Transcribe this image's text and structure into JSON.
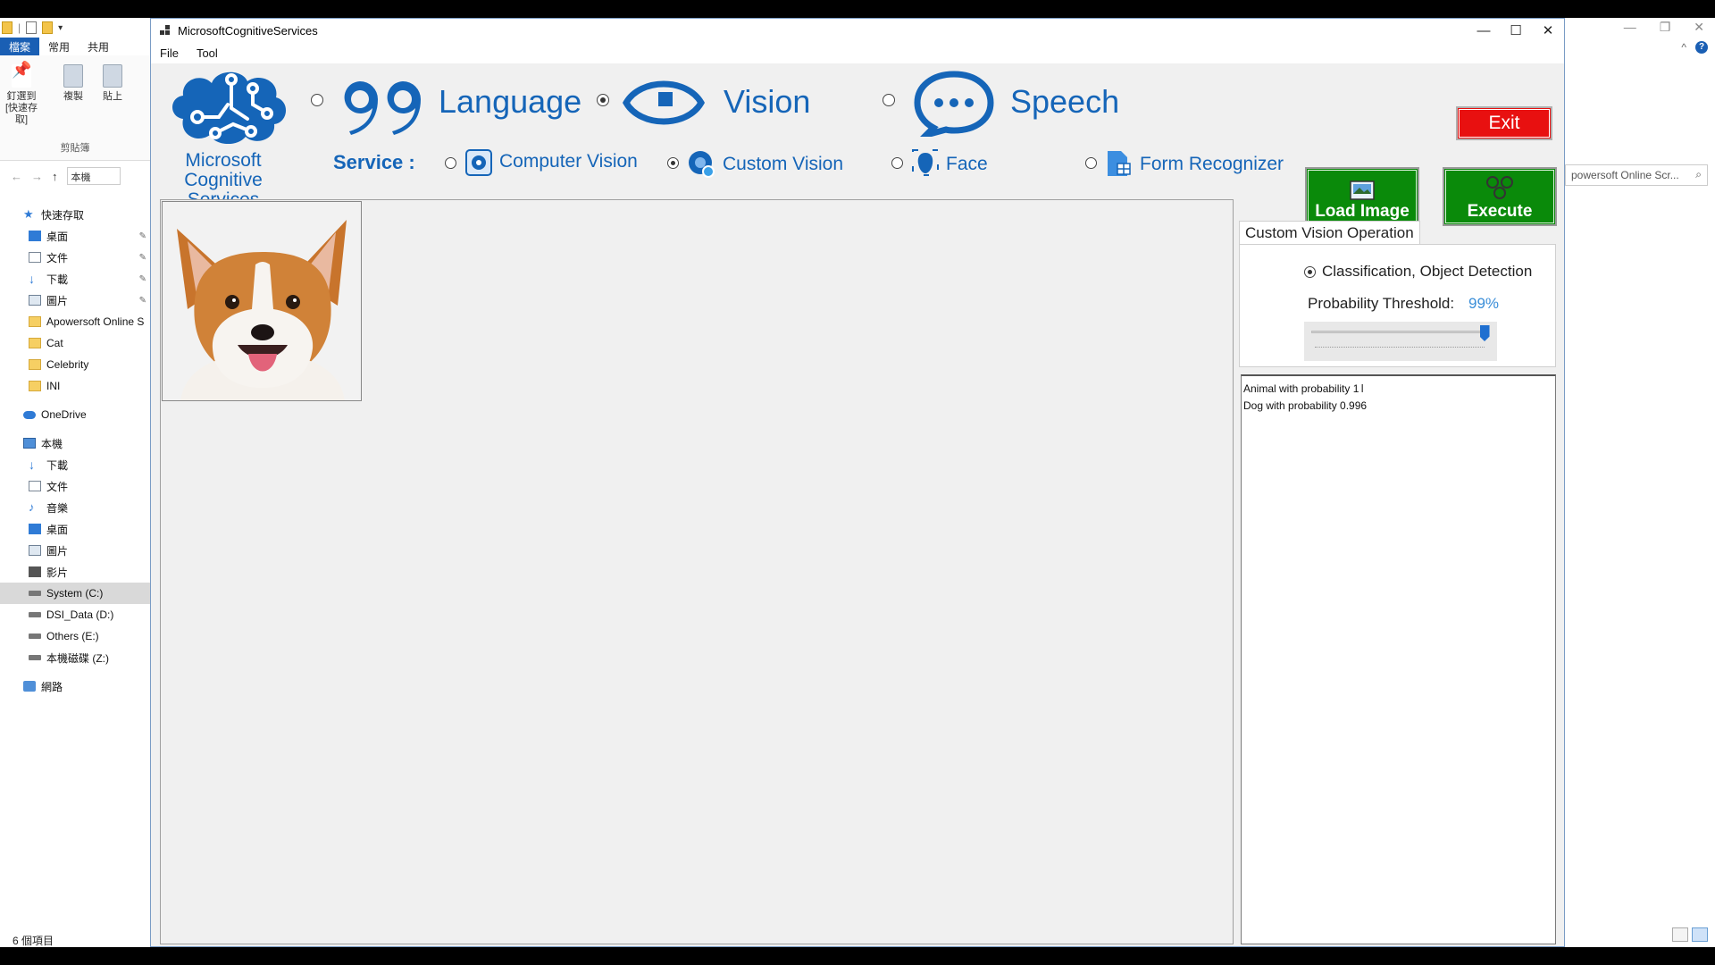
{
  "explorer": {
    "ribbon_tabs": [
      "檔案",
      "常用",
      "共用"
    ],
    "ribbon_buttons": [
      "釘選到[快速存取]",
      "複製",
      "貼上"
    ],
    "ribbon_group": "剪貼簿",
    "address_crumb": "本機",
    "search_placeholder": "powersoft Online Scr...",
    "nav": {
      "quick_access": "快速存取",
      "quick_items": [
        "桌面",
        "文件",
        "下載",
        "圖片"
      ],
      "folders": [
        "Apowersoft Online S",
        "Cat",
        "Celebrity",
        "INI"
      ],
      "onedrive": "OneDrive",
      "this_pc": "本機",
      "pc_items": [
        "下載",
        "文件",
        "音樂",
        "桌面",
        "圖片",
        "影片"
      ],
      "drives": [
        "System (C:)",
        "DSI_Data (D:)",
        "Others (E:)",
        "本機磁碟 (Z:)"
      ],
      "network": "網路"
    },
    "status": "6 個項目"
  },
  "app": {
    "title": "MicrosoftCognitiveServices",
    "menu": [
      "File",
      "Tool"
    ],
    "logo_line1": "Microsoft",
    "logo_line2": "Cognitive Services",
    "categories": [
      {
        "label": "Language",
        "selected": false
      },
      {
        "label": "Vision",
        "selected": true
      },
      {
        "label": "Speech",
        "selected": false
      }
    ],
    "service_label": "Service :",
    "services": [
      {
        "label": "Computer Vision",
        "selected": false
      },
      {
        "label": "Custom Vision",
        "selected": true
      },
      {
        "label": "Face",
        "selected": false
      },
      {
        "label": "Form Recognizer",
        "selected": false
      }
    ],
    "exit_label": "Exit",
    "load_image_label": "Load Image",
    "execute_label": "Execute",
    "operation_tab": "Custom Vision Operation",
    "operation_option": "Classification, Object Detection",
    "threshold_label": "Probability Threshold:",
    "threshold_value": "99%",
    "threshold_fraction": 0.99,
    "results": [
      "Animal with probability 1",
      "Dog with probability 0.996"
    ]
  },
  "colors": {
    "brand_blue": "#1565b8",
    "exit_red": "#e81010",
    "action_green": "#0a8a0a",
    "threshold_blue": "#3a8ed8"
  }
}
